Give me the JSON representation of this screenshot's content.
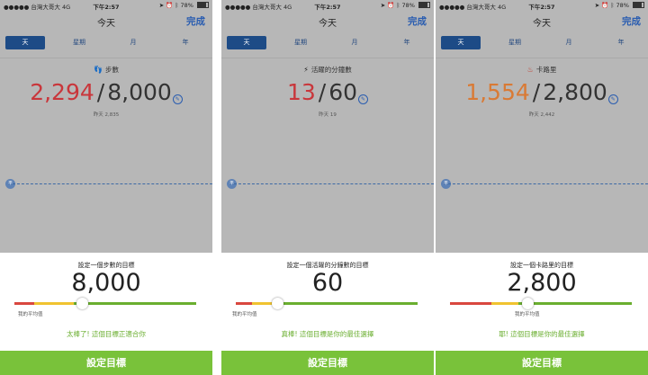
{
  "status_bar": {
    "carrier": "●●●●● 台灣大哥大  4G",
    "time": "下午2:57",
    "battery": "78%",
    "icons": [
      "location-icon",
      "alarm-icon",
      "bluetooth-icon",
      "battery-icon"
    ]
  },
  "header": {
    "title": "今天",
    "done": "完成"
  },
  "tabs": [
    "天",
    "星期",
    "月",
    "年"
  ],
  "selected_tab": "天",
  "colors": {
    "accent_blue": "#1d4b86",
    "link_blue": "#2a5db0",
    "green": "#79c23a",
    "steps_red": "#c9363b",
    "calories_orange": "#d97a35"
  },
  "screens": [
    {
      "metric_icon": "footprints-icon",
      "metric_label": "步數",
      "current": "2,294",
      "goal": "8,000",
      "yesterday": "昨天 2,835",
      "avg_marker": "平",
      "sheet_label": "設定一個步數的目標",
      "goal_value": "8,000",
      "slider_position": 0.37,
      "avg_label": "我的平均值",
      "feedback": "太棒了! 這個目標正適合你",
      "button": "設定目標"
    },
    {
      "metric_icon": "lightning-icon",
      "metric_label": "活躍的分鐘數",
      "current": "13",
      "goal": "60",
      "yesterday": "昨天 19",
      "avg_marker": "平",
      "sheet_label": "設定一個活躍的分鐘數的目標",
      "goal_value": "60",
      "slider_position": 0.22,
      "avg_label": "我的平均值",
      "feedback": "真棒! 這個目標是你的最佳選擇",
      "button": "設定目標"
    },
    {
      "metric_icon": "flame-icon",
      "metric_label": "卡路里",
      "current": "1,554",
      "goal": "2,800",
      "yesterday": "昨天 2,442",
      "avg_marker": "平",
      "sheet_label": "設定一個卡路里的目標",
      "goal_value": "2,800",
      "slider_position": 0.41,
      "avg_label": "我的平均值",
      "feedback": "耶! 這個目標是你的最佳選擇",
      "button": "設定目標"
    }
  ]
}
